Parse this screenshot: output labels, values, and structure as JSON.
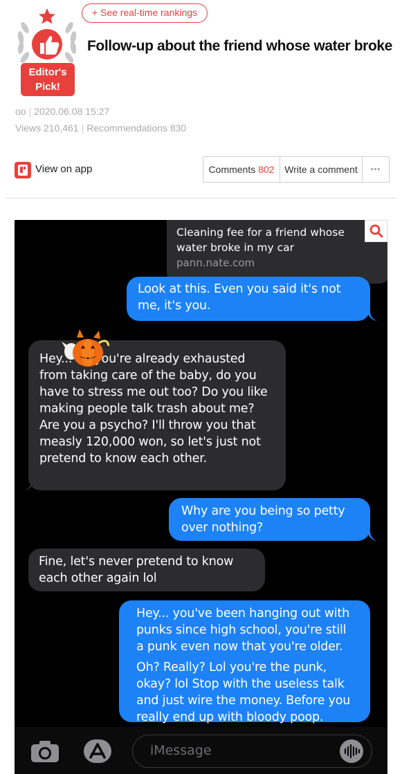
{
  "header": {
    "rankings_button": "+ See real-time rankings",
    "badge_label_line1": "Editor's",
    "badge_label_line2": "Pick!",
    "title": "Follow-up about the friend whose water broke",
    "author": "oo",
    "date": "2020.06.08 15:27",
    "views_label": "Views",
    "views_count": "210,461",
    "recommendations_label": "Recommendations",
    "recommendations_count": "830",
    "app_link": "View on app",
    "comments_label": "Comments",
    "comments_count": "802",
    "write_comment": "Write a comment",
    "more": "•••",
    "accent_color": "#e8403c"
  },
  "chat": {
    "link_preview": {
      "title_line1": "Cleaning fee for a friend whose",
      "title_line2": "water broke in my car",
      "domain": "pann.nate.com"
    },
    "messages": [
      {
        "side": "sent",
        "text": "Look at this. Even you said it's not me, it's you."
      },
      {
        "side": "received",
        "text": "Hey... ..., you're already exhausted from taking care of the baby, do you have to stress me out too? Do you like making people talk trash about me? Are you a psycho? I'll throw you that measly 120,000 won, so let's just not pretend to know each other."
      },
      {
        "side": "sent",
        "text": "Why are you being so petty over nothing?"
      },
      {
        "side": "received",
        "text": "Fine, let's never pretend to know each other again lol"
      },
      {
        "side": "sent",
        "text": "Hey... you've been hanging out with punks since high school, you're still a punk even now that you're older."
      },
      {
        "side": "sent",
        "text": "Oh? Really? Lol you're the punk, okay? lol Stop with the useless talk and just wire the money. Before you really end up with bloody poop."
      }
    ],
    "input_placeholder": "iMessage",
    "sent_color": "#1d82f6",
    "received_color": "#2c2c2e"
  }
}
